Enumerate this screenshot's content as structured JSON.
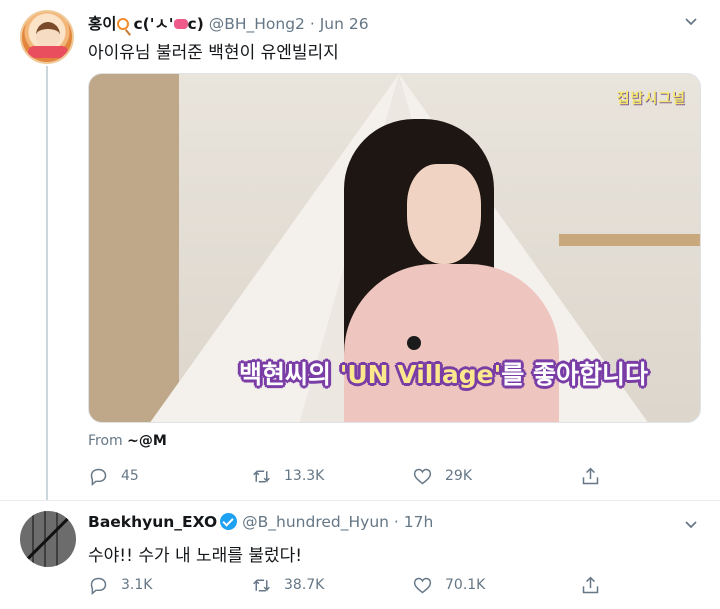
{
  "tweets": [
    {
      "display_name": "홍이",
      "display_name_suffix_1": "c('ㅅ'",
      "display_name_suffix_2": "c)",
      "handle": "@BH_Hong2",
      "separator": "·",
      "time": "Jun 26",
      "text": "아이유님 불러준 백현이 유엔빌리지",
      "media": {
        "caption_prefix": "백현씨의 ",
        "caption_highlight": "'UN Village'",
        "caption_suffix": "를 좋아합니다",
        "logo_text": "집밥시그널"
      },
      "from_label": "From",
      "from_source": "~@M",
      "actions": {
        "reply": "45",
        "retweet": "13.3K",
        "like": "29K"
      },
      "icons": [
        "chevron-down-icon",
        "reply-icon",
        "retweet-icon",
        "like-icon",
        "share-icon",
        "lollipop-icon",
        "candy-icon"
      ]
    },
    {
      "display_name": "Baekhyun_EXO",
      "verified": true,
      "handle": "@B_hundred_Hyun",
      "separator": "·",
      "time": "17h",
      "text": "수야!! 수가 내 노래를 불렀다!",
      "actions": {
        "reply": "3.1K",
        "retweet": "38.7K",
        "like": "70.1K"
      },
      "icons": [
        "chevron-down-icon",
        "verified-badge-icon",
        "reply-icon",
        "retweet-icon",
        "like-icon",
        "share-icon"
      ]
    }
  ],
  "colors": {
    "text": "#14171a",
    "secondary": "#657786",
    "verified": "#1da1f2",
    "divider": "#e6ecf0",
    "caption_outline": "#7a3da6"
  }
}
